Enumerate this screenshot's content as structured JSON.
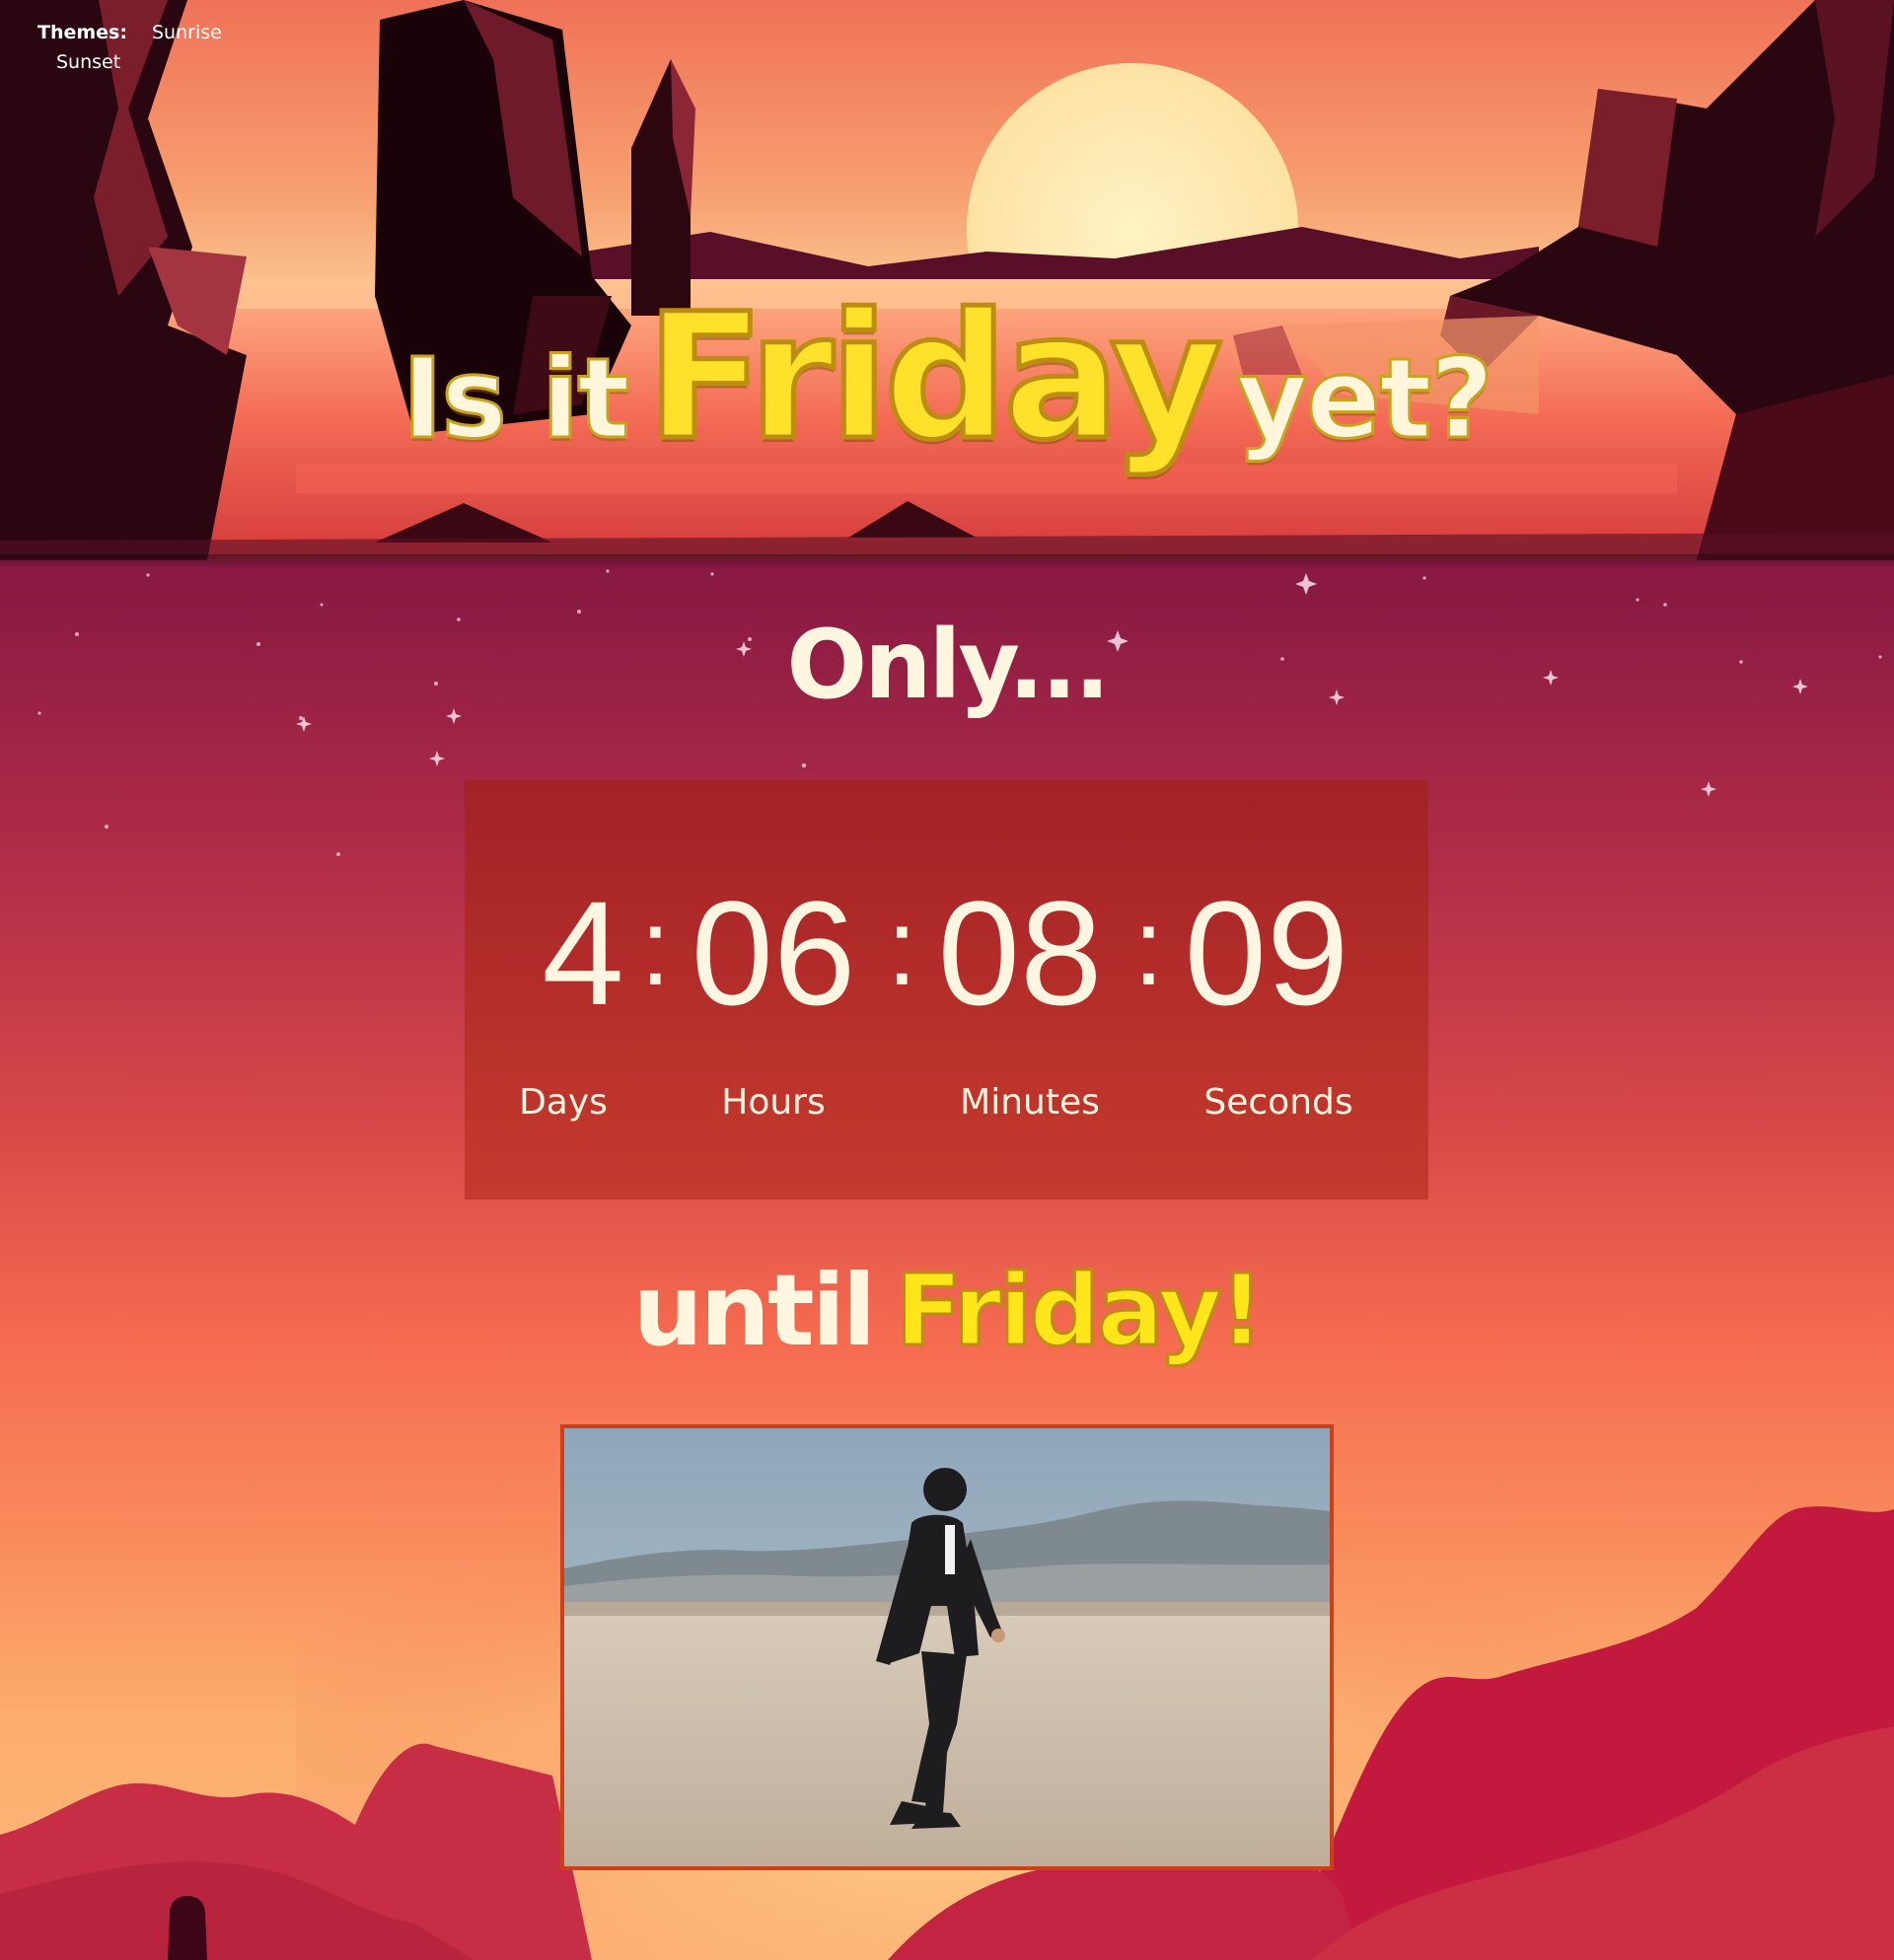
{
  "themes": {
    "label": "Themes:",
    "options": [
      "Sunrise",
      "Sunset"
    ]
  },
  "title": {
    "part1": "Is it",
    "highlight": "Friday",
    "part2": "yet?"
  },
  "intro": "Only...",
  "countdown": {
    "days": "4",
    "hours": "06",
    "minutes": "08",
    "seconds": "09",
    "separator": ":",
    "labels": {
      "days": "Days",
      "hours": "Hours",
      "minutes": "Minutes",
      "seconds": "Seconds"
    }
  },
  "outro": {
    "text": "until",
    "highlight": "Friday!"
  },
  "colors": {
    "accent_yellow": "#ffe02a",
    "cream": "#fff6e0",
    "panel_red": "#b42e2a"
  }
}
